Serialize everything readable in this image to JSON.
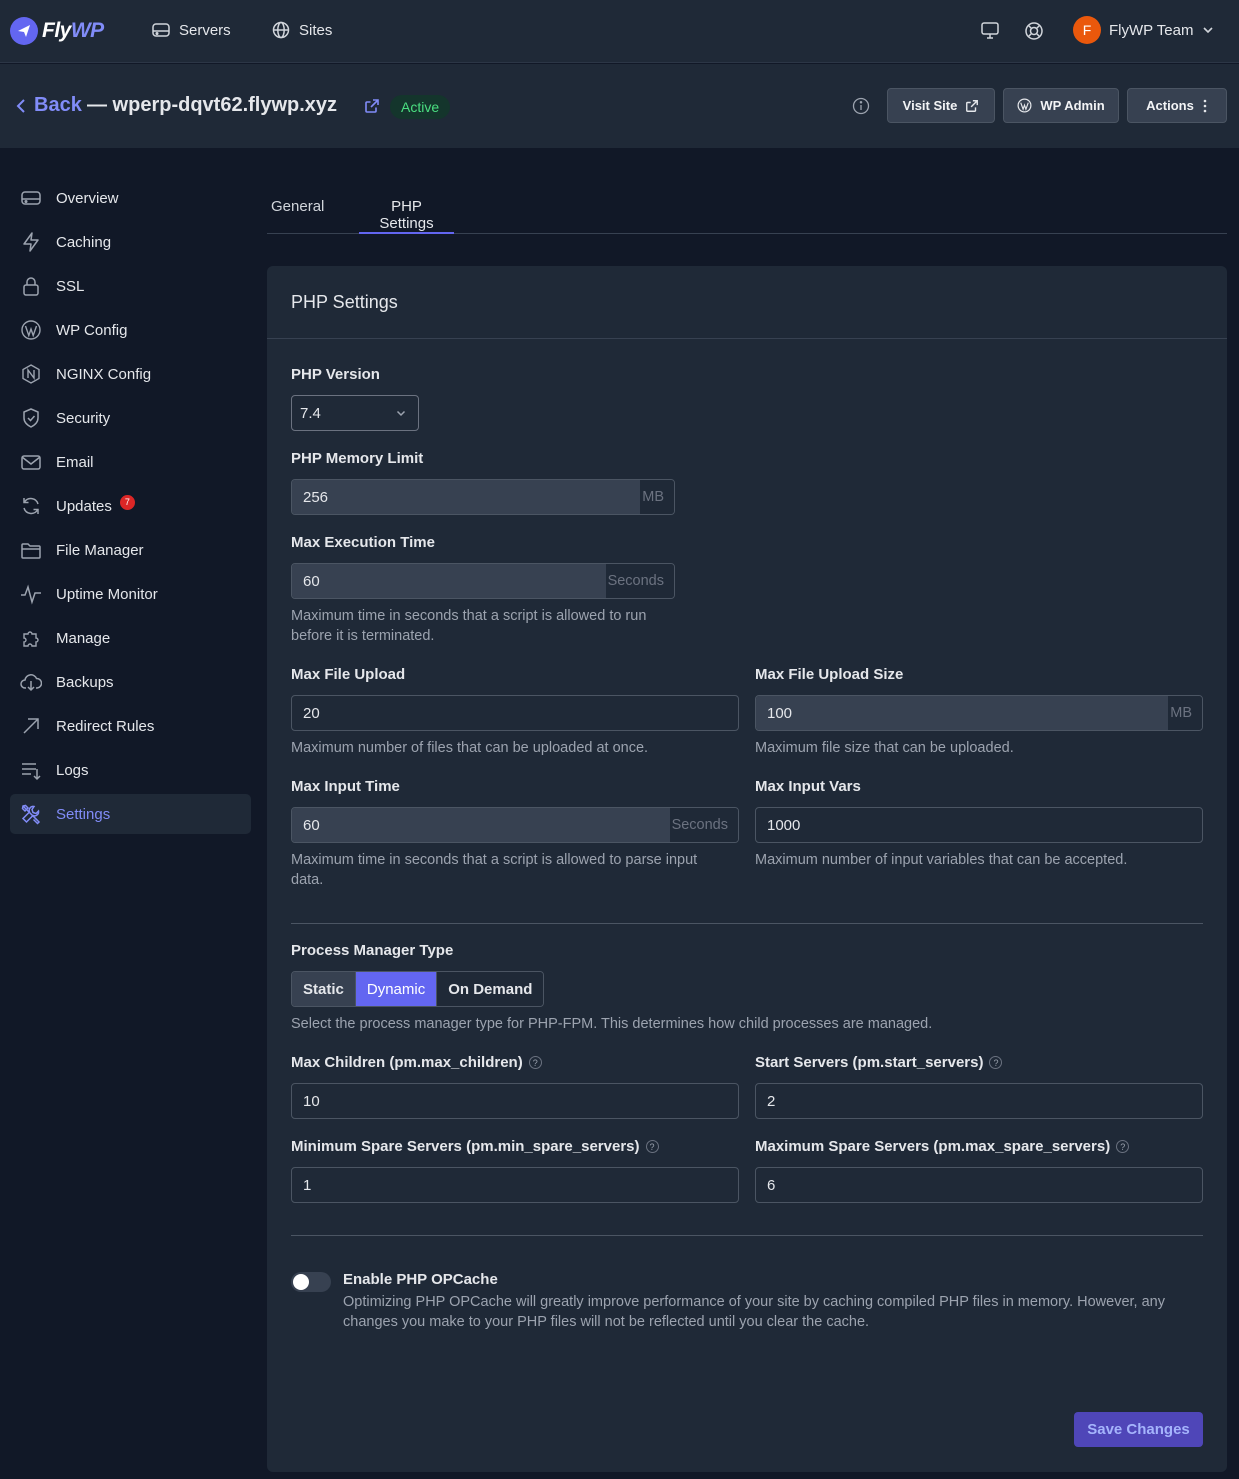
{
  "brand": {
    "name_fly": "Fly",
    "name_wp": "WP"
  },
  "nav": {
    "servers": "Servers",
    "sites": "Sites",
    "team_initial": "F",
    "team_name": "FlyWP Team"
  },
  "header": {
    "back": "Back",
    "site_title": "— wperp-dqvt62.flywp.xyz",
    "status": "Active",
    "visit_site": "Visit Site",
    "wp_admin": "WP Admin",
    "actions": "Actions"
  },
  "sidebar": {
    "items": [
      {
        "label": "Overview",
        "icon": "server-icon"
      },
      {
        "label": "Caching",
        "icon": "bolt-icon"
      },
      {
        "label": "SSL",
        "icon": "lock-icon"
      },
      {
        "label": "WP Config",
        "icon": "wordpress-icon"
      },
      {
        "label": "NGINX Config",
        "icon": "nginx-icon"
      },
      {
        "label": "Security",
        "icon": "shield-icon"
      },
      {
        "label": "Email",
        "icon": "mail-icon"
      },
      {
        "label": "Updates",
        "icon": "refresh-icon",
        "badge": "7"
      },
      {
        "label": "File Manager",
        "icon": "folder-icon"
      },
      {
        "label": "Uptime Monitor",
        "icon": "pulse-icon"
      },
      {
        "label": "Manage",
        "icon": "puzzle-icon"
      },
      {
        "label": "Backups",
        "icon": "cloud-download-icon"
      },
      {
        "label": "Redirect Rules",
        "icon": "arrow-up-right-icon"
      },
      {
        "label": "Logs",
        "icon": "list-icon"
      },
      {
        "label": "Settings",
        "icon": "tools-icon",
        "active": true
      }
    ]
  },
  "tabs": {
    "general": "General",
    "php_settings": "PHP Settings"
  },
  "card": {
    "title": "PHP Settings",
    "php_version": {
      "label": "PHP Version",
      "value": "7.4"
    },
    "memory_limit": {
      "label": "PHP Memory Limit",
      "value": "256",
      "suffix": "MB"
    },
    "max_exec": {
      "label": "Max Execution Time",
      "value": "60",
      "suffix": "Seconds",
      "help": "Maximum time in seconds that a script is allowed to run before it is terminated."
    },
    "max_file_upload": {
      "label": "Max File Upload",
      "value": "20",
      "help": "Maximum number of files that can be uploaded at once."
    },
    "max_upload_size": {
      "label": "Max File Upload Size",
      "value": "100",
      "suffix": "MB",
      "help": "Maximum file size that can be uploaded."
    },
    "max_input_time": {
      "label": "Max Input Time",
      "value": "60",
      "suffix": "Seconds",
      "help": "Maximum time in seconds that a script is allowed to parse input data."
    },
    "max_input_vars": {
      "label": "Max Input Vars",
      "value": "1000",
      "help": "Maximum number of input variables that can be accepted."
    },
    "pm_type": {
      "label": "Process Manager Type",
      "options": [
        "Static",
        "Dynamic",
        "On Demand"
      ],
      "selected": "Dynamic",
      "help": "Select the process manager type for PHP-FPM. This determines how child processes are managed."
    },
    "max_children": {
      "label": "Max Children (pm.max_children)",
      "value": "10"
    },
    "start_servers": {
      "label": "Start Servers (pm.start_servers)",
      "value": "2"
    },
    "min_spare": {
      "label": "Minimum Spare Servers (pm.min_spare_servers)",
      "value": "1"
    },
    "max_spare": {
      "label": "Maximum Spare Servers (pm.max_spare_servers)",
      "value": "6"
    },
    "opcache": {
      "label": "Enable PHP OPCache",
      "enabled": false,
      "desc": "Optimizing PHP OPCache will greatly improve performance of your site by caching compiled PHP files in memory. However, any changes you make to your PHP files will not be reflected until you clear the cache."
    },
    "save": "Save Changes"
  },
  "colors": {
    "accent": "#6366f1",
    "accent_light": "#818cf8",
    "success": "#4ade80",
    "danger": "#dc2626"
  }
}
